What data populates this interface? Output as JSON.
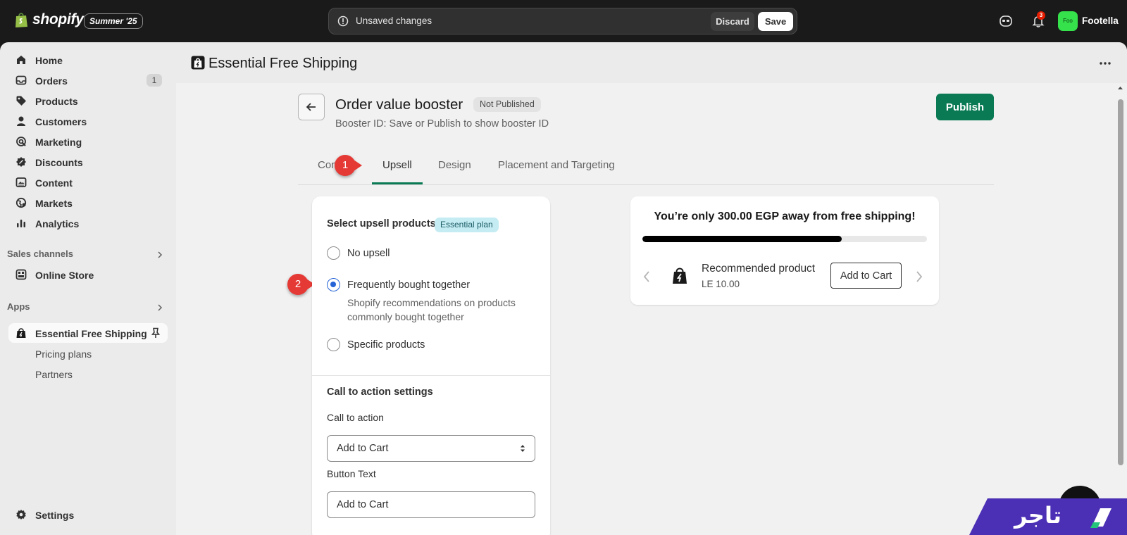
{
  "topbar": {
    "logo_text": "shopify",
    "edition": "Summer '25",
    "unsaved_message": "Unsaved changes",
    "discard_label": "Discard",
    "save_label": "Save",
    "notification_count": "3",
    "store_avatar_text": "Foo",
    "store_name": "Footella"
  },
  "sidebar": {
    "items": [
      {
        "label": "Home",
        "icon": "home-icon"
      },
      {
        "label": "Orders",
        "icon": "inbox-icon",
        "count": "1"
      },
      {
        "label": "Products",
        "icon": "tag-icon"
      },
      {
        "label": "Customers",
        "icon": "person-icon"
      },
      {
        "label": "Marketing",
        "icon": "target-icon"
      },
      {
        "label": "Discounts",
        "icon": "discount-icon"
      },
      {
        "label": "Content",
        "icon": "image-icon"
      },
      {
        "label": "Markets",
        "icon": "globe-icon"
      },
      {
        "label": "Analytics",
        "icon": "bar-chart-icon"
      }
    ],
    "sales_channels_heading": "Sales channels",
    "online_store_label": "Online Store",
    "apps_heading": "Apps",
    "app_label": "Essential Free Shipping",
    "app_subitems": [
      "Pricing plans",
      "Partners"
    ],
    "settings_label": "Settings"
  },
  "app_header": {
    "title": "Essential Free Shipping"
  },
  "page": {
    "title": "Order value booster",
    "status": "Not Published",
    "booster_id": "Booster ID: Save or Publish to show booster ID",
    "publish_label": "Publish"
  },
  "tabs": [
    {
      "label": "Content",
      "visible_text": "Con"
    },
    {
      "label": "Upsell"
    },
    {
      "label": "Design"
    },
    {
      "label": "Placement and Targeting"
    }
  ],
  "active_tab": "Upsell",
  "callouts": [
    "1",
    "2"
  ],
  "upsell": {
    "heading": "Select upsell products",
    "plan_badge": "Essential plan",
    "options": [
      {
        "label": "No upsell",
        "checked": false
      },
      {
        "label": "Frequently bought together",
        "checked": true,
        "help": "Shopify recommendations on products commonly bought together"
      },
      {
        "label": "Specific products",
        "checked": false
      }
    ]
  },
  "cta": {
    "heading": "Call to action settings",
    "call_to_action_label": "Call to action",
    "call_to_action_value": "Add to Cart",
    "button_text_label": "Button Text",
    "button_text_value": "Add to Cart"
  },
  "preview": {
    "message": "You’re only 300.00 EGP away from free shipping!",
    "progress_fraction": 0.7,
    "product_name": "Recommended product",
    "product_price": "LE 10.00",
    "add_button": "Add to Cart"
  },
  "watermark": {
    "text": "تاجر"
  },
  "colors": {
    "accent": "#0a7a55",
    "topbar_bg": "#1a1a1a",
    "callout": "#e53935",
    "radio_checked": "#2563d6",
    "watermark_bg": "#4b2fb5"
  }
}
